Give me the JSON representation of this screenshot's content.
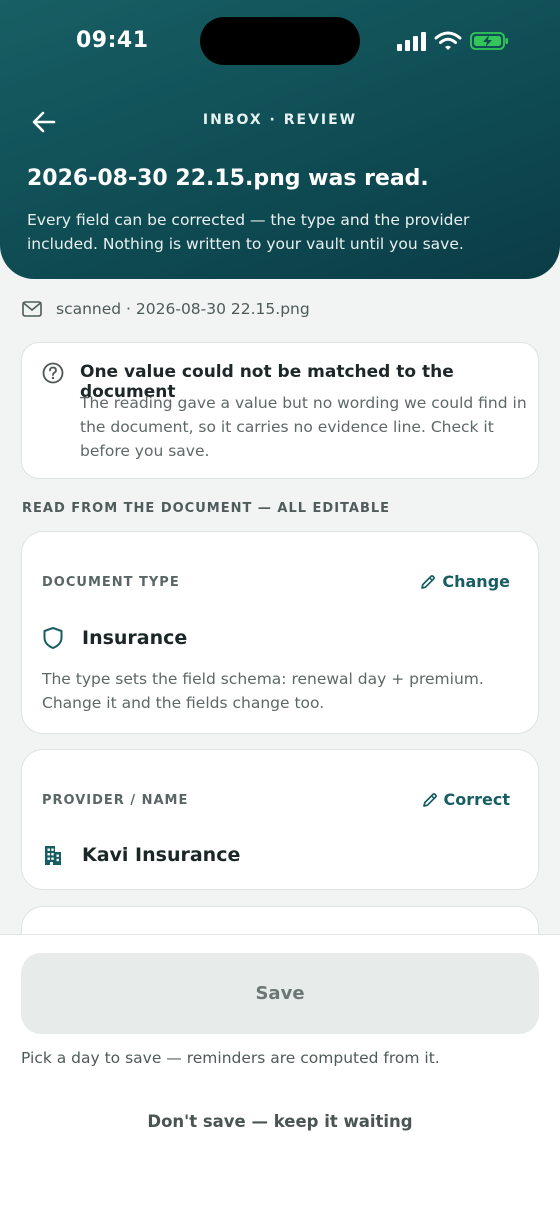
{
  "status_bar": {
    "time": "09:41",
    "icons": [
      "signal-icon",
      "wifi-icon",
      "battery-charging-icon"
    ],
    "battery_color": "#33c759"
  },
  "nav": {
    "back_icon": "arrow-left-icon",
    "title": "INBOX · REVIEW"
  },
  "hero": {
    "title": "2026-08-30 22.15.png was read.",
    "subtitle": "Every field can be corrected — the type and the provider included. Nothing is written to your vault until you save."
  },
  "source": {
    "icon": "mail-icon",
    "text": "scanned · 2026-08-30 22.15.png"
  },
  "warning": {
    "icon": "question-circle-icon",
    "title": "One value could not be matched to the document",
    "body": "The reading gave a value but no wording we could find in the document, so it carries no evidence line. Check it before you save."
  },
  "section_label": "READ FROM THE DOCUMENT — ALL EDITABLE",
  "fields": {
    "document_type": {
      "label": "DOCUMENT TYPE",
      "action": "Change",
      "action_icon": "pencil-icon",
      "value_icon": "shield-icon",
      "value": "Insurance",
      "note": "The type sets the field schema: renewal day + premium. Change it and the fields change too."
    },
    "provider": {
      "label": "PROVIDER / NAME",
      "action": "Correct",
      "action_icon": "pencil-icon",
      "value_icon": "building-icon",
      "value": "Kavi Insurance"
    }
  },
  "footer": {
    "save_label": "Save",
    "hint": "Pick a day to save — reminders are computed from it.",
    "dont_save_label": "Don't save — keep it waiting"
  },
  "colors": {
    "header_gradient_start": "#175f64",
    "header_gradient_end": "#0b3c46",
    "accent": "#175e63",
    "background": "#f1f4f3"
  }
}
